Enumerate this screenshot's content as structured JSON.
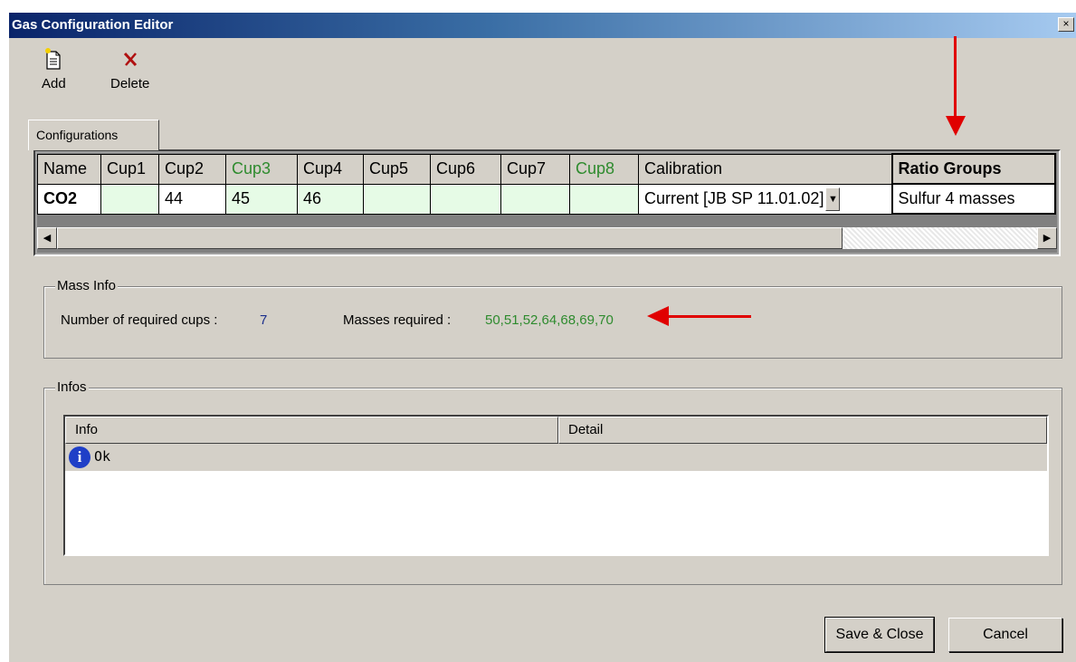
{
  "window": {
    "title": "Gas Configuration Editor",
    "close_glyph": "×"
  },
  "toolbar": {
    "add": {
      "label": "Add",
      "icon": "add-document-icon"
    },
    "delete": {
      "label": "Delete",
      "icon": "delete-x-icon"
    }
  },
  "tab": {
    "label": "Configurations"
  },
  "grid": {
    "headers": [
      "Name",
      "Cup1",
      "Cup2",
      "Cup3",
      "Cup4",
      "Cup5",
      "Cup6",
      "Cup7",
      "Cup8",
      "Calibration",
      "Ratio Groups"
    ],
    "row": {
      "name": "CO2",
      "cups": [
        "",
        "44",
        "45",
        "46",
        "",
        "",
        "",
        ""
      ],
      "calibration": "Current [JB SP 11.01.02]",
      "ratio_group": "Sulfur 4 masses"
    }
  },
  "mass_info": {
    "legend": "Mass Info",
    "cups_label": "Number of required cups :",
    "cups_value": "7",
    "masses_label": "Masses required :",
    "masses_value": "50,51,52,64,68,69,70"
  },
  "infos": {
    "legend": "Infos",
    "col_info": "Info",
    "col_detail": "Detail",
    "rows": [
      {
        "icon": "info-icon",
        "text": "Ok",
        "detail": ""
      }
    ]
  },
  "buttons": {
    "save": "Save & Close",
    "cancel": "Cancel"
  },
  "colors": {
    "accent_green": "#2e8b2e",
    "value_blue": "#1a2e8c",
    "annotation_red": "#e00000",
    "row_bg": "#e6fbe6"
  }
}
